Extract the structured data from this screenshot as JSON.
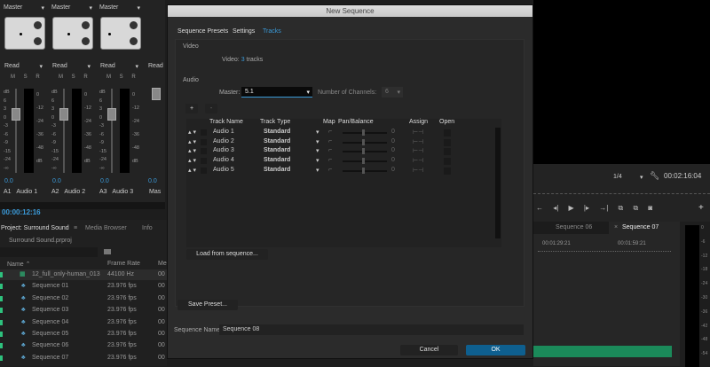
{
  "mixer": {
    "channels": [
      {
        "output": "Master",
        "automation": "Read",
        "value": "0.0",
        "id": "A1",
        "name": "Audio 1"
      },
      {
        "output": "Master",
        "automation": "Read",
        "value": "0.0",
        "id": "A2",
        "name": "Audio 2"
      },
      {
        "output": "Master",
        "automation": "Read",
        "value": "0.0",
        "id": "A3",
        "name": "Audio 3"
      }
    ],
    "master": {
      "automation": "Read",
      "value": "0.0",
      "name": "Mas"
    },
    "msr": "M S R",
    "fader_scale": [
      "dB",
      "6",
      "3",
      "0",
      "-3",
      "-6",
      "-9",
      "-15",
      "-24",
      "-∞"
    ],
    "meter_scale": [
      "0",
      "-12",
      "-24",
      "-36",
      "-48",
      "dB"
    ],
    "timecode": "00:00:12:16"
  },
  "project": {
    "tabs": [
      "Project: Surround Sound",
      "Media Browser",
      "Info"
    ],
    "file": "Surround Sound.prproj",
    "columns": [
      "Name",
      "Frame Rate",
      "Me"
    ],
    "items": [
      {
        "name": "12_full_only-human_013",
        "rate": "44100 Hz",
        "media": "00"
      },
      {
        "name": "Sequence 01",
        "rate": "23.976 fps",
        "media": "00"
      },
      {
        "name": "Sequence 02",
        "rate": "23.976 fps",
        "media": "00"
      },
      {
        "name": "Sequence 03",
        "rate": "23.976 fps",
        "media": "00"
      },
      {
        "name": "Sequence 04",
        "rate": "23.976 fps",
        "media": "00"
      },
      {
        "name": "Sequence 05",
        "rate": "23.976 fps",
        "media": "00"
      },
      {
        "name": "Sequence 06",
        "rate": "23.976 fps",
        "media": "00"
      },
      {
        "name": "Sequence 07",
        "rate": "23.976 fps",
        "media": "00"
      }
    ]
  },
  "monitor": {
    "resolution": "1/4",
    "timecode": "00:02:16:04"
  },
  "timeline": {
    "tabs": [
      "Sequence 06",
      "Sequence 07"
    ],
    "ruler": [
      "00:01:29:21",
      "00:01:59:21"
    ],
    "meter_scale": [
      "0",
      "-6",
      "-12",
      "-18",
      "-24",
      "-30",
      "-36",
      "-42",
      "-48",
      "-54"
    ]
  },
  "dialog": {
    "title": "New Sequence",
    "tabs": [
      "Sequence Presets",
      "Settings",
      "Tracks"
    ],
    "video": {
      "section": "Video",
      "label": "Video:",
      "count": "3",
      "unit": "tracks"
    },
    "audio": {
      "section": "Audio",
      "master_label": "Master:",
      "master_value": "5.1",
      "channels_label": "Number of Channels:",
      "channels_value": "6",
      "add": "+",
      "remove": "-",
      "columns": [
        "Track Name",
        "Track Type",
        "Map",
        "Pan/Balance",
        "Assign",
        "Open"
      ],
      "tracks": [
        {
          "name": "Audio 1",
          "type": "Standard",
          "pan": "0"
        },
        {
          "name": "Audio 2",
          "type": "Standard",
          "pan": "0"
        },
        {
          "name": "Audio 3",
          "type": "Standard",
          "pan": "0"
        },
        {
          "name": "Audio 4",
          "type": "Standard",
          "pan": "0"
        },
        {
          "name": "Audio 5",
          "type": "Standard",
          "pan": "0"
        }
      ],
      "load": "Load from sequence..."
    },
    "save_preset": "Save Preset...",
    "name_label": "Sequence Name:",
    "name_value": "Sequence 08",
    "cancel": "Cancel",
    "ok": "OK"
  },
  "colors": {
    "accent": "#3a9ad9",
    "ok": "#0e5f8f",
    "clip": "#1b8a5a"
  }
}
